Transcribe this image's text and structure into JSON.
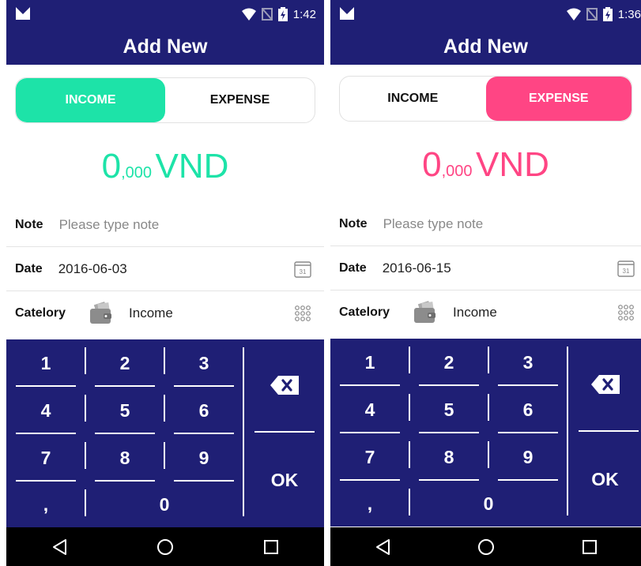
{
  "screens": [
    {
      "status": {
        "time": "1:42"
      },
      "title": "Add New",
      "toggle": {
        "income_label": "INCOME",
        "expense_label": "EXPENSE",
        "selected": "INCOME"
      },
      "amount": {
        "value": "0",
        "suffix": ",000",
        "currency": "VND"
      },
      "note": {
        "label": "Note",
        "placeholder": "Please type note"
      },
      "date": {
        "label": "Date",
        "value": "2016-06-03",
        "icon_text": "31"
      },
      "category": {
        "label": "Catelory",
        "value": "Income"
      },
      "keypad": {
        "k1": "1",
        "k2": "2",
        "k3": "3",
        "k4": "4",
        "k5": "5",
        "k6": "6",
        "k7": "7",
        "k8": "8",
        "k9": "9",
        "comma": ",",
        "k0": "0",
        "ok": "OK"
      }
    },
    {
      "status": {
        "time": "1:36"
      },
      "title": "Add New",
      "toggle": {
        "income_label": "INCOME",
        "expense_label": "EXPENSE",
        "selected": "EXPENSE"
      },
      "amount": {
        "value": "0",
        "suffix": ",000",
        "currency": "VND"
      },
      "note": {
        "label": "Note",
        "placeholder": "Please type note"
      },
      "date": {
        "label": "Date",
        "value": "2016-06-15",
        "icon_text": "31"
      },
      "category": {
        "label": "Catelory",
        "value": "Income"
      },
      "keypad": {
        "k1": "1",
        "k2": "2",
        "k3": "3",
        "k4": "4",
        "k5": "5",
        "k6": "6",
        "k7": "7",
        "k8": "8",
        "k9": "9",
        "comma": ",",
        "k0": "0",
        "ok": "OK"
      }
    }
  ],
  "colors": {
    "primary": "#1f1f75",
    "income_accent": "#1de3a8",
    "expense_accent": "#ff4584",
    "navbar": "#000000"
  },
  "icons": [
    "app-logo-icon",
    "wifi-icon",
    "no-signal-icon",
    "battery-charging-icon",
    "calendar-icon",
    "wallet-icon",
    "grid-icon",
    "backspace-icon",
    "nav-back-icon",
    "nav-home-icon",
    "nav-recents-icon"
  ]
}
